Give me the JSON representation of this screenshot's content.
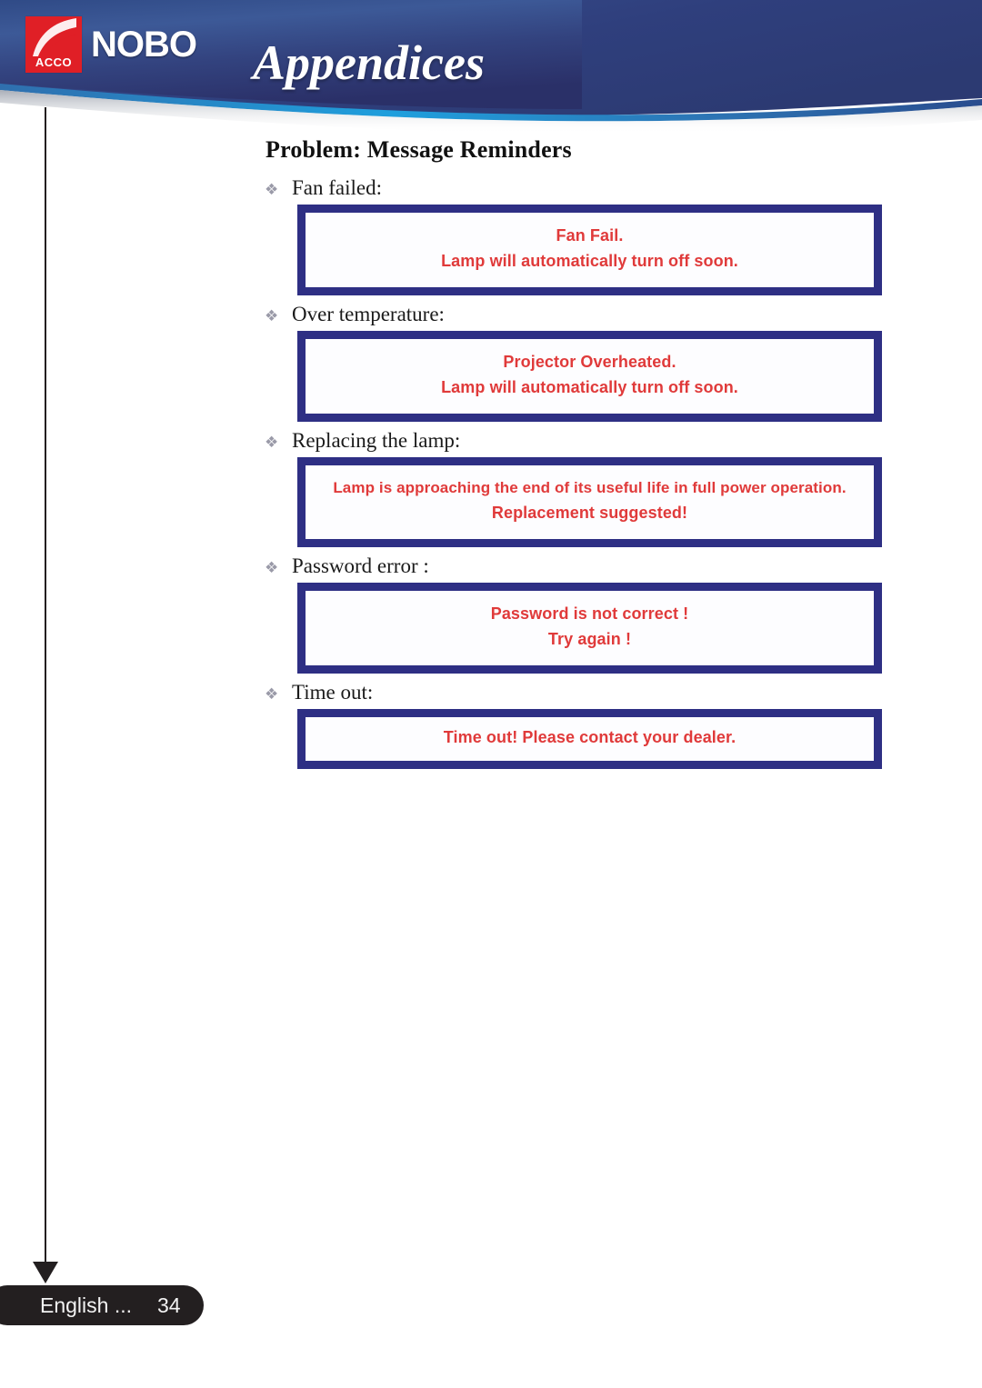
{
  "header": {
    "logo": {
      "brand_mark_text": "ACCO",
      "brand_word": "NOBO",
      "mark_color": "#e01f26"
    },
    "title": "Appendices",
    "banner_color_dark": "#2b3a72",
    "banner_color_mid": "#3b5596",
    "banner_highlight": "#1b8fd0"
  },
  "section": {
    "heading": "Problem: Message Reminders",
    "bullet_glyph": "❖"
  },
  "messages": [
    {
      "label": "Fan failed:",
      "lines": [
        "Fan Fail.",
        "Lamp will automatically turn off soon."
      ]
    },
    {
      "label": "Over temperature:",
      "lines": [
        "Projector Overheated.",
        "Lamp will automatically turn off soon."
      ]
    },
    {
      "label": "Replacing the lamp:",
      "lines": [
        "Lamp is approaching the end of its useful life in full power operation.",
        "Replacement suggested!"
      ]
    },
    {
      "label": "Password error :",
      "lines": [
        "Password is not correct !",
        "Try again !"
      ]
    },
    {
      "label": "Time out:",
      "lines": [
        "Time out! Please contact your dealer."
      ]
    }
  ],
  "osd": {
    "border_color": "#2e2f84",
    "text_color": "#e03a3a",
    "background_color": "#fdfdff"
  },
  "footer": {
    "language": "English ...",
    "page_number": "34",
    "bar_color": "#231f20"
  }
}
